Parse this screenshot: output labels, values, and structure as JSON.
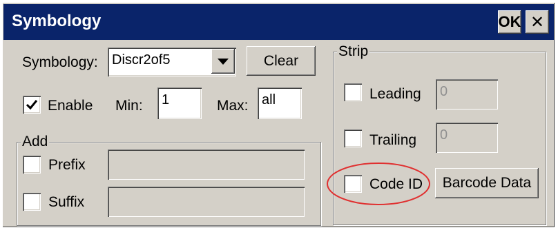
{
  "window": {
    "title": "Symbology",
    "ok_label": "OK",
    "close_label": "✕"
  },
  "main": {
    "symbology_label": "Symbology:",
    "symbology_value": "Discr2of5",
    "clear_label": "Clear",
    "enable_label": "Enable",
    "enable_checked": true,
    "min_label": "Min:",
    "min_value": "1",
    "max_label": "Max:",
    "max_value": "all"
  },
  "add_group": {
    "title": "Add",
    "prefix_label": "Prefix",
    "prefix_value": "",
    "suffix_label": "Suffix",
    "suffix_value": ""
  },
  "strip_group": {
    "title": "Strip",
    "leading_label": "Leading",
    "leading_value": "0",
    "trailing_label": "Trailing",
    "trailing_value": "0",
    "code_id_label": "Code ID",
    "barcode_data_label": "Barcode Data"
  },
  "colors": {
    "titlebar": "#0a246a",
    "face": "#d4d0c8",
    "highlight_circle": "#e03030"
  },
  "icons": {
    "dropdown": "chevron-down-icon",
    "check": "check-icon",
    "close": "close-icon"
  }
}
